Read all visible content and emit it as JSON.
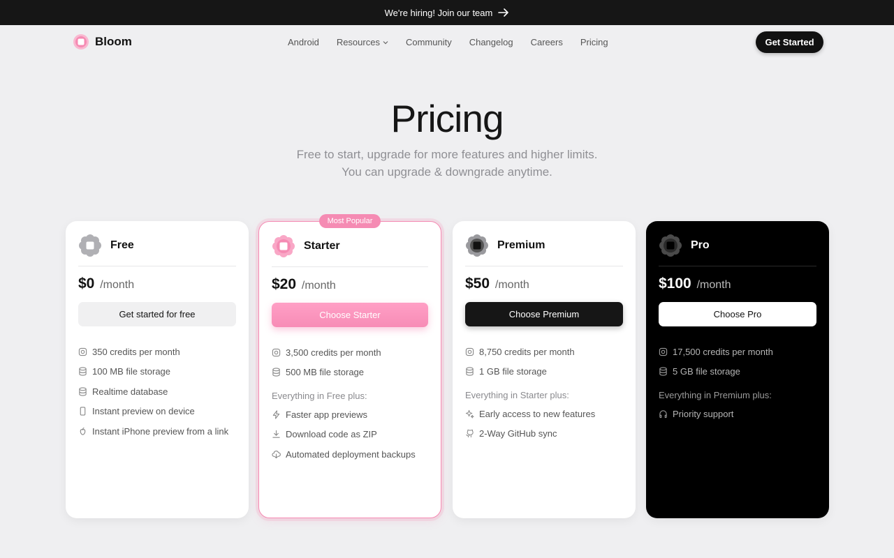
{
  "banner": {
    "text": "We're hiring! Join our team"
  },
  "nav": {
    "logo": "Bloom",
    "links": [
      "Android",
      "Resources",
      "Community",
      "Changelog",
      "Careers",
      "Pricing"
    ],
    "cta": "Get Started"
  },
  "hero": {
    "title": "Pricing",
    "subtitle_line1": "Free to start, upgrade for more features and higher limits.",
    "subtitle_line2": "You can upgrade & downgrade anytime."
  },
  "badge": "Most Popular",
  "colors": {
    "accent": "#f58bb3",
    "dark": "#161616"
  },
  "plans": [
    {
      "name": "Free",
      "price": "$0",
      "period": "/month",
      "cta": "Get started for free",
      "features": [
        "350 credits per month",
        "100 MB file storage",
        "Realtime database",
        "Instant preview on device",
        "Instant iPhone preview from a link"
      ],
      "section": "",
      "extras": []
    },
    {
      "name": "Starter",
      "price": "$20",
      "period": "/month",
      "cta": "Choose Starter",
      "features": [
        "3,500 credits per month",
        "500 MB file storage"
      ],
      "section": "Everything in Free plus:",
      "extras": [
        "Faster app previews",
        "Download code as ZIP",
        "Automated deployment backups"
      ]
    },
    {
      "name": "Premium",
      "price": "$50",
      "period": "/month",
      "cta": "Choose Premium",
      "features": [
        "8,750 credits per month",
        "1 GB file storage"
      ],
      "section": "Everything in Starter plus:",
      "extras": [
        "Early access to new features",
        "2-Way GitHub sync"
      ]
    },
    {
      "name": "Pro",
      "price": "$100",
      "period": "/month",
      "cta": "Choose Pro",
      "features": [
        "17,500 credits per month",
        "5 GB file storage"
      ],
      "section": "Everything in Premium plus:",
      "extras": [
        "Priority support"
      ]
    }
  ]
}
